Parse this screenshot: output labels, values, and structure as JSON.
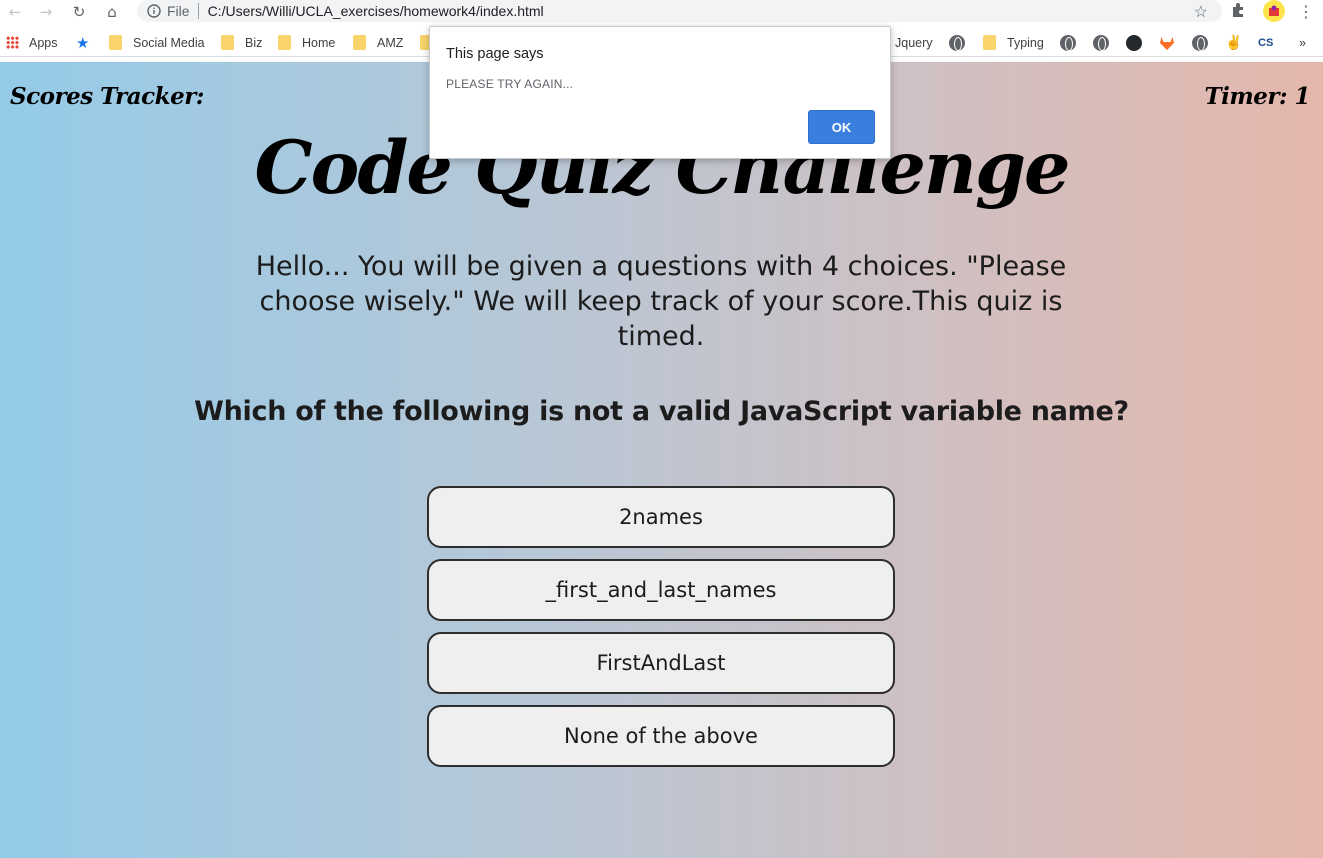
{
  "browser": {
    "url_scheme_label": "File",
    "url": "C:/Users/Willi/UCLA_exercises/homework4/index.html"
  },
  "bookmarks": {
    "apps": "Apps",
    "items": [
      "Social Media",
      "Biz",
      "Home",
      "AMZ",
      "Jquery",
      "Typing"
    ],
    "overflow": "»"
  },
  "page": {
    "scores_label": "Scores Tracker:",
    "timer_label": "Timer: 1",
    "title": "Code Quiz Challenge",
    "intro": "Hello... You will be given a questions with 4 choices. \"Please choose wisely.\" We will keep track of your score.This quiz is timed.",
    "question": "Which of the following is not a valid JavaScript variable name?",
    "choices": [
      "2names",
      "_first_and_last_names",
      "FirstAndLast",
      "None of the above"
    ]
  },
  "dialog": {
    "title": "This page says",
    "message": "PLEASE TRY AGAIN...",
    "ok_label": "OK"
  },
  "colors": {
    "gradient_left": "#94cbe9",
    "gradient_right": "#e5b7ab",
    "dialog_button": "#3b7fde"
  }
}
